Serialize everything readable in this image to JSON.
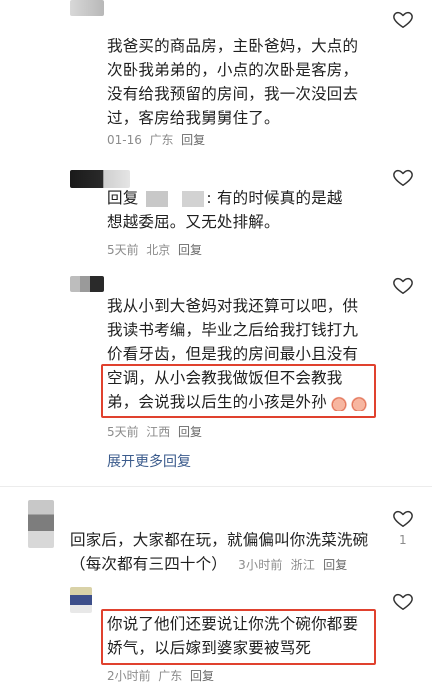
{
  "comments": [
    {
      "text_lines": [
        "我爸买的商品房，主卧爸妈，大点的",
        "次卧我弟弟的，小点的次卧是客房，",
        "没有给我预留的房间，我一次没回去",
        "过，客房给我舅舅住了。"
      ],
      "date": "01-16",
      "location": "广东",
      "reply": "回复"
    },
    {
      "reply_prefix": "回复",
      "text_lines": [
        ": 有的时候真的是越",
        "想越委屈。又无处排解。"
      ],
      "date": "5天前",
      "location": "北京",
      "reply": "回复"
    },
    {
      "text_lines": [
        "我从小到大爸妈对我还算可以吧，供",
        "我读书考编，毕业之后给我打钱打九",
        "价看牙齿，但是我的房间最小且没有",
        "空调，从小会教我做饭但不会教我",
        "弟，会说我以后生的小孩是外孙"
      ],
      "date": "5天前",
      "location": "江西",
      "reply": "回复"
    },
    {
      "text_lines": [
        "回家后，大家都在玩，就偏偏叫你洗菜洗碗",
        "（每次都有三四十个）"
      ],
      "date": "3小时前",
      "location": "浙江",
      "reply": "回复",
      "like_count": "1"
    },
    {
      "text_lines": [
        "你说了他们还要说让你洗个碗你都要",
        "娇气，以后嫁到婆家要被骂死"
      ],
      "date": "2小时前",
      "location": "广东",
      "reply": "回复"
    }
  ],
  "expand_more": "展开更多回复",
  "colors": {
    "highlight": "#e0412e",
    "meta": "#8c8c8c",
    "link": "#3b5b8c"
  },
  "icons": {
    "like": "heart-outline-icon",
    "emoji": "sad-face-emoji-icon"
  }
}
